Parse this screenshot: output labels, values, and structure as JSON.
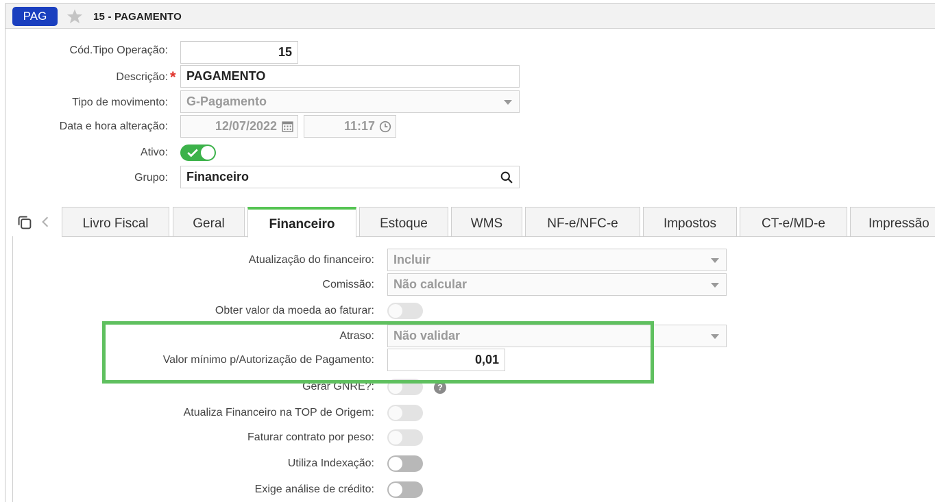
{
  "header": {
    "badge": "PAG",
    "title": "15 - PAGAMENTO"
  },
  "form": {
    "cod_label": "Cód.Tipo Operação:",
    "cod_value": "15",
    "desc_label": "Descrição:",
    "desc_required": "*",
    "desc_value": "PAGAMENTO",
    "tipo_label": "Tipo de movimento:",
    "tipo_value": "G-Pagamento",
    "data_label": "Data e hora alteração:",
    "data_value": "12/07/2022",
    "hora_value": "11:17",
    "ativo_label": "Ativo:",
    "ativo_on": true,
    "grupo_label": "Grupo:",
    "grupo_value": "Financeiro"
  },
  "tabs": [
    {
      "label": "Livro Fiscal",
      "active": false
    },
    {
      "label": "Geral",
      "active": false
    },
    {
      "label": "Financeiro",
      "active": true
    },
    {
      "label": "Estoque",
      "active": false
    },
    {
      "label": "WMS",
      "active": false
    },
    {
      "label": "NF-e/NFC-e",
      "active": false
    },
    {
      "label": "Impostos",
      "active": false
    },
    {
      "label": "CT-e/MD-e",
      "active": false
    },
    {
      "label": "Impressão",
      "active": false
    }
  ],
  "financeiro": {
    "atualizacao_label": "Atualização do financeiro:",
    "atualizacao_value": "Incluir",
    "comissao_label": "Comissão:",
    "comissao_value": "Não calcular",
    "obter_label": "Obter valor da moeda ao faturar:",
    "atraso_label": "Atraso:",
    "atraso_value": "Não validar",
    "valor_minimo_label": "Valor mínimo p/Autorização de Pagamento:",
    "valor_minimo_value": "0,01",
    "gerar_gnre_label": "Gerar GNRE?:",
    "help_glyph": "?",
    "atualiza_origem_label": "Atualiza Financeiro na TOP de Origem:",
    "faturar_peso_label": "Faturar contrato por peso:",
    "indexacao_label": "Utiliza Indexação:",
    "analise_credito_label": "Exige análise de crédito:"
  },
  "colors": {
    "badge": "#1a3fbf",
    "toggle_on": "#3cb24a",
    "highlight": "#5fc05f",
    "active_tab_top": "#55c452",
    "required": "#e0332b"
  }
}
